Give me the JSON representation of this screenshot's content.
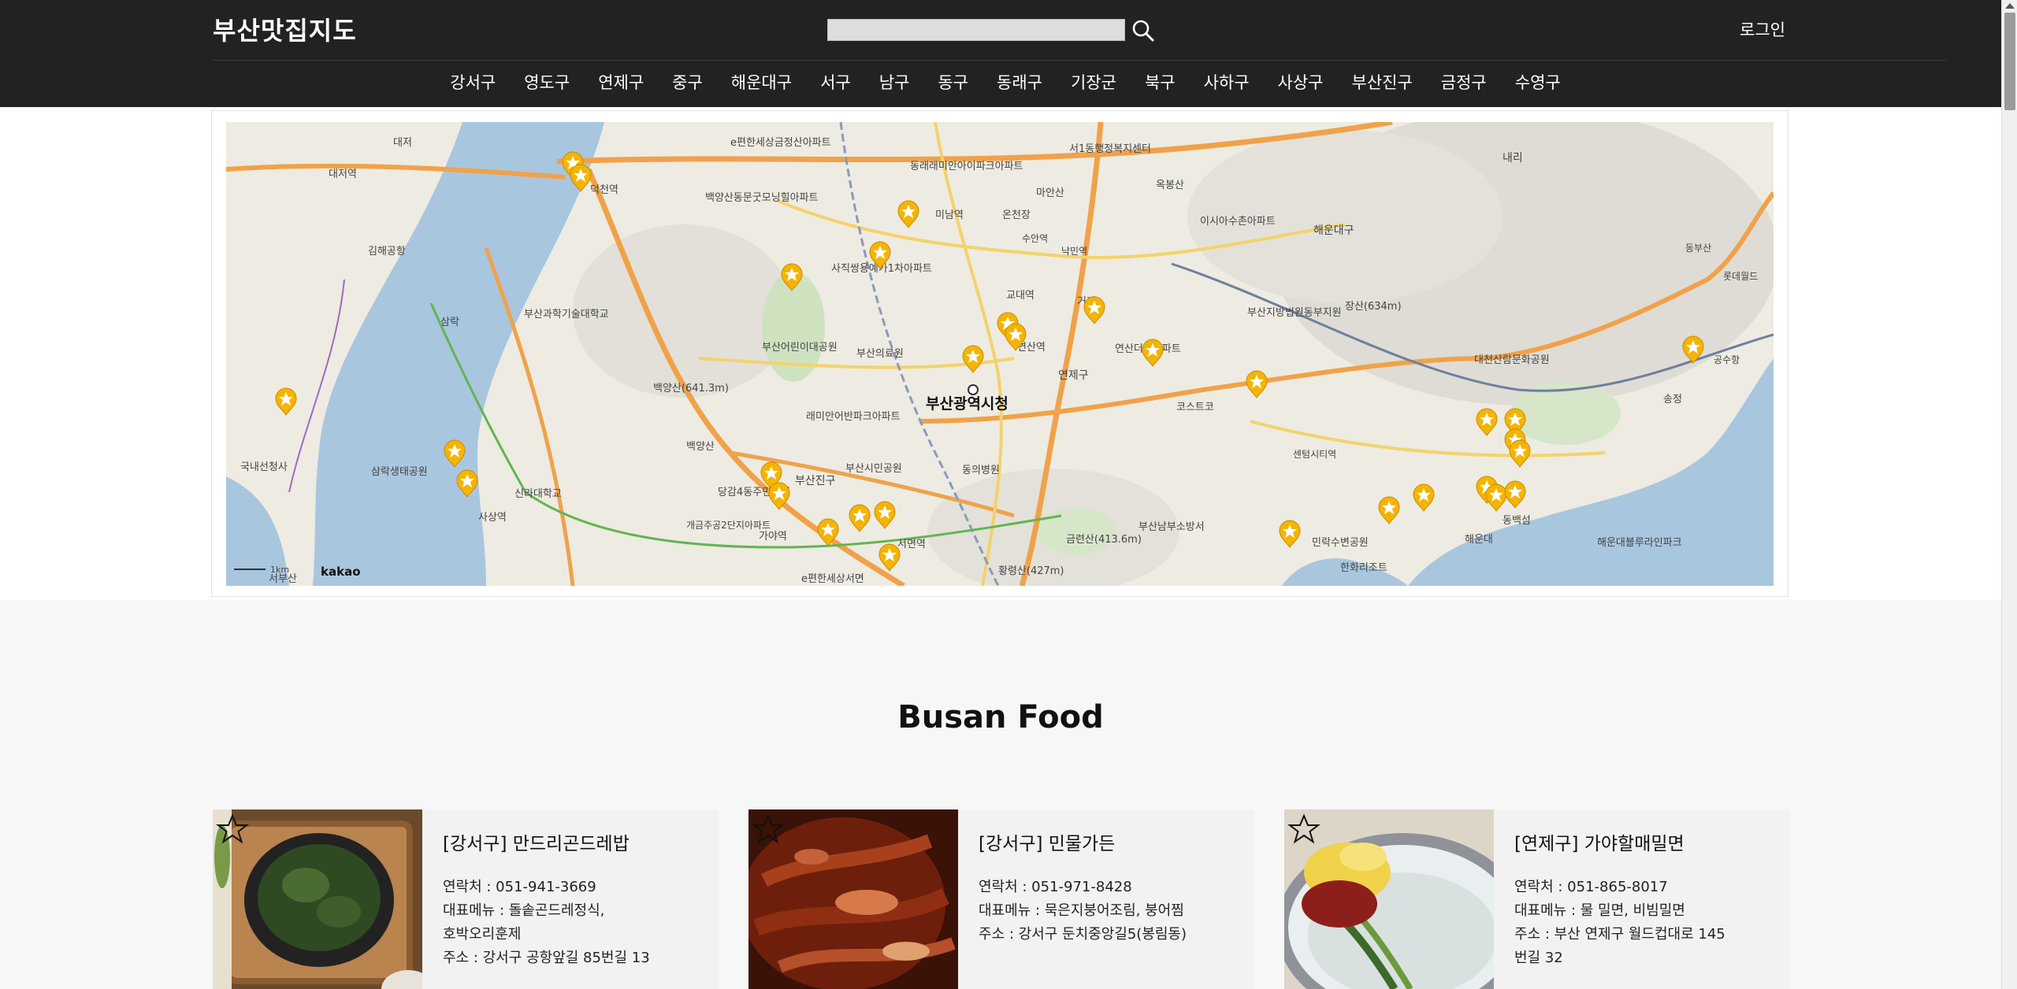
{
  "header": {
    "brand": "부산맛집지도",
    "search": {
      "value": "",
      "placeholder": ""
    },
    "login_label": "로그인",
    "districts": [
      "강서구",
      "영도구",
      "연제구",
      "중구",
      "해운대구",
      "서구",
      "남구",
      "동구",
      "동래구",
      "기장군",
      "북구",
      "사하구",
      "사상구",
      "부산진구",
      "금정구",
      "수영구"
    ]
  },
  "map": {
    "center_label": "부산광역시청",
    "places": [
      "대저",
      "대저역",
      "덕천역",
      "백양산동문굿모닝힐아파트",
      "e편한세상금정산아파트",
      "동래래미안아이파크아파트",
      "서1동행정복지센터",
      "미남역",
      "마안산",
      "온천장",
      "수안역",
      "낙민역",
      "옥봉산",
      "이시아수촌아파트",
      "해운대구",
      "내리",
      "동부산",
      "롯데월드",
      "사직쌍용예가1차아파트",
      "교대역",
      "거제",
      "연산역",
      "연산더샵아파트",
      "김해공항",
      "부산과학기술대학교",
      "삼락",
      "부산어린이대공원",
      "부산의료원",
      "부산지방법원동부지원",
      "장산(634m)",
      "대천산람문화공원",
      "송정",
      "공수항",
      "백양산(641.3m)",
      "연제구",
      "코스트코",
      "국내선청사",
      "삼락생태공원",
      "신라대학교",
      "래미안어반파크아파트",
      "백양산",
      "동의병원",
      "당감4동주민센터",
      "부산진구",
      "부산시민공원",
      "사상역",
      "개금주공2단지아파트",
      "가야역",
      "서면역",
      "황령산(427m)",
      "금련산(413.6m)",
      "부산남부소방서",
      "센텀시티역",
      "해운대",
      "동백섬",
      "해운대블루라인파크",
      "민락수변공원",
      "한화리조트",
      "e편한세상서면",
      "서부산"
    ],
    "logo": "kakao",
    "scale_text": "1km",
    "marker_icon": "star-marker-icon"
  },
  "section_title": "Busan Food",
  "restaurants": [
    {
      "title": "[강서구] 만드리곤드레밥",
      "lines": [
        "연락처 : 051-941-3669",
        "대표메뉴 : 돌솥곤드레정식,",
        "호박오리훈제",
        "주소 : 강서구 공항앞길 85번길 13"
      ],
      "image": "stone-pot-rice-photo"
    },
    {
      "title": "[강서구] 민물가든",
      "lines": [
        "연락처 : 051-971-8428",
        "대표메뉴 : 묵은지붕어조림, 붕어찜",
        "주소 : 강서구 둔치중앙길5(봉림동)"
      ],
      "image": "braised-kimchi-fish-photo"
    },
    {
      "title": "[연제구] 가야할매밀면",
      "lines": [
        "연락처 : 051-865-8017",
        "대표메뉴 : 물 밀면, 비빔밀면",
        "주소 : 부산 연제구 월드컵대로 145",
        "번길 32"
      ],
      "image": "cold-noodle-photo"
    }
  ],
  "colors": {
    "header_bg": "#222222",
    "marker": "#f5b400",
    "road": "#f0a24a",
    "water": "#a9c6df",
    "green": "#cfe2c0"
  }
}
